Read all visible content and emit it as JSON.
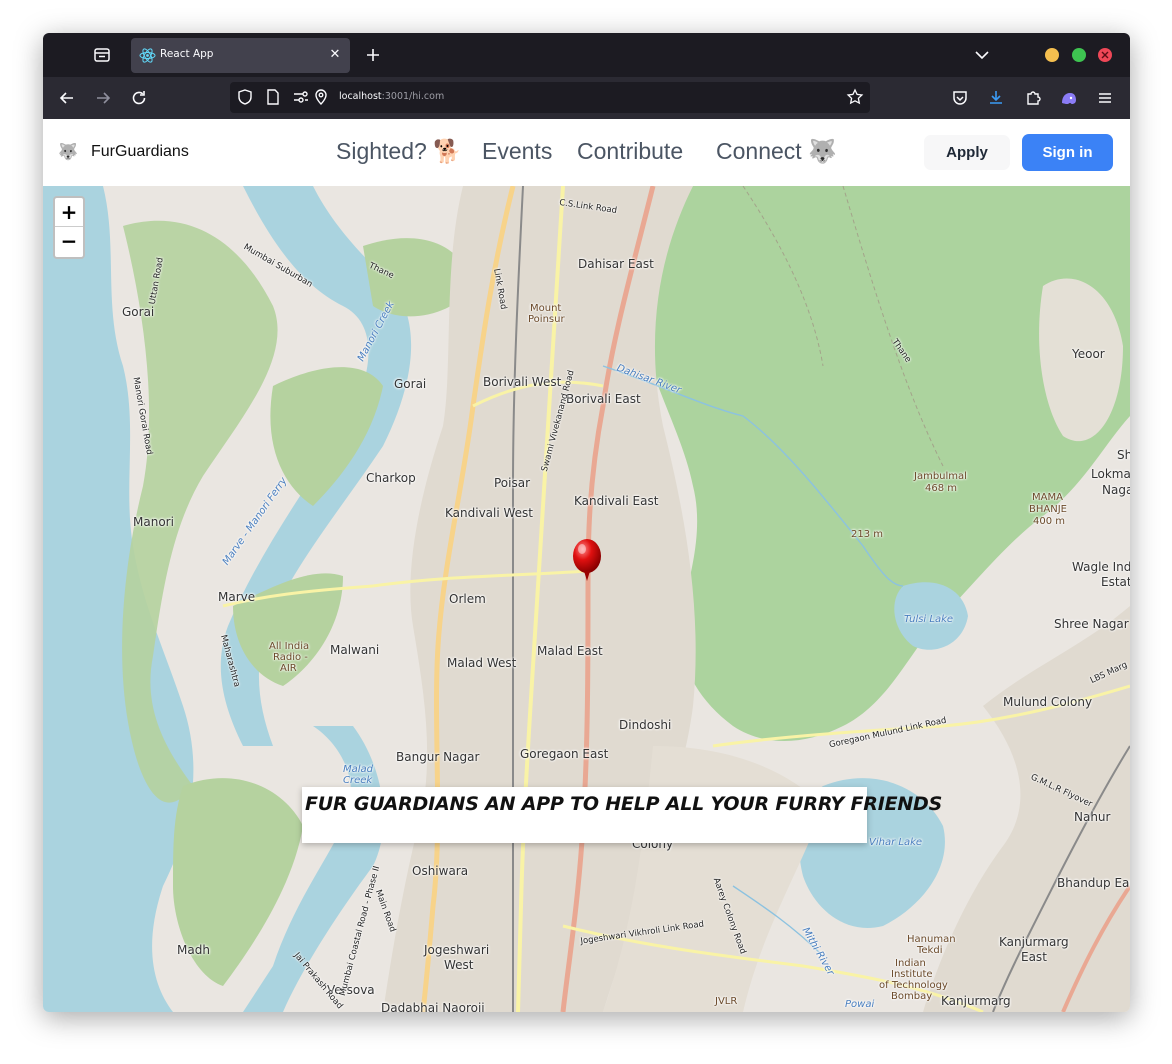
{
  "browser": {
    "tab": {
      "title": "React App",
      "favicon": "react-icon",
      "close_glyph": "✕"
    },
    "url": {
      "host": "localhost",
      "rest": ":3001/hi.com"
    },
    "icons": [
      "tab-list-icon",
      "new-tab-icon",
      "tab-overflow-chevron-icon",
      "back-icon",
      "forward-icon",
      "reload-icon",
      "shield-icon",
      "page-icon",
      "permissions-icon",
      "location-icon",
      "bookmark-star-icon",
      "pocket-icon",
      "downloads-icon",
      "extensions-icon",
      "extension-ghost-icon",
      "menu-icon"
    ],
    "colors": {
      "tabstrip": "#1c1b22",
      "tab_active": "#42414d",
      "toolbar": "#2b2a33"
    }
  },
  "app": {
    "brand": {
      "logo": "🐺",
      "name": "FurGuardians"
    },
    "nav": [
      {
        "label": "Sighted? 🐕"
      },
      {
        "label": "Events"
      },
      {
        "label": "Contribute"
      },
      {
        "label": "Connect 🐺"
      }
    ],
    "apply_label": "Apply",
    "signin_label": "Sign in",
    "colors": {
      "primary": "#3b82f6"
    }
  },
  "map": {
    "zoom_in_label": "+",
    "zoom_out_label": "−",
    "marker_icon": "map-pin-icon",
    "banner_text": "FUR GUARDIANS AN APP TO HELP ALL YOUR FURRY FRIENDS",
    "places": {
      "dahisar_east": "Dahisar East",
      "mount_poinsur_1": "Mount",
      "mount_poinsur_2": "Poinsur",
      "gorai_north": "Gorai",
      "gorai": "Gorai",
      "borivali_west": "Borivali West",
      "borivali_east": "Borivali East",
      "charkop": "Charkop",
      "poisar": "Poisar",
      "kandivali_east": "Kandivali East",
      "kandivali_west": "Kandivali West",
      "manori": "Manori",
      "marve": "Marve",
      "orlem": "Orlem",
      "malwani": "Malwani",
      "malad_west": "Malad West",
      "malad_east": "Malad East",
      "dindoshi": "Dindoshi",
      "bangur_nagar": "Bangur Nagar",
      "goregaon_east": "Goregaon East",
      "oshiwara": "Oshiwara",
      "jogeshwari_1": "Jogeshwari",
      "jogeshwari_2": "West",
      "madh": "Madh",
      "versova": "Versova",
      "dadabhai": "Dadabhai Naoroji",
      "colony": "Colony",
      "yeoor": "Yeoor",
      "lokmanya": "Lokma",
      "nagar_right": "Naga",
      "sh": "Sh",
      "wagle": "Wagle Ind",
      "estate": "Estat",
      "shree_nagar": "Shree Nagar",
      "mulund_colony": "Mulund Colony",
      "nahur": "Nahur",
      "bhandup": "Bhandup Eas",
      "kanjurmarg_e1": "Kanjurmarg",
      "kanjurmarg_e2": "East",
      "kanjurmarg": "Kanjurmarg",
      "hanuman_1": "Hanuman",
      "hanuman_2": "Tekdi",
      "iit_1": "Indian",
      "iit_2": "Institute",
      "iit_3": "of Technology",
      "iit_4": "Bombay",
      "jvlr": "JVLR",
      "powai": "Powai",
      "jambulmal_1": "Jambulmal",
      "jambulmal_2": "468 m",
      "mama_1": "MAMA",
      "mama_2": "BHANJE",
      "mama_3": "400 m",
      "peak_213": "213 m",
      "tulsi_lake": "Tulsi Lake",
      "vihar_lake": "Vihar Lake",
      "malad_creek_1": "Malad",
      "malad_creek_2": "Creek",
      "air_1": "All India",
      "air_2": "Radio -",
      "air_3": "AIR",
      "manori_creek": "Manori Creek",
      "marve_ferry": "Marve - Manori Ferry",
      "thane_west": "Thane",
      "thane_east": "Thane",
      "dahisar_river": "Dahisar River",
      "mithi_river": "Mithi River",
      "cs_link": "C.S.Link Road",
      "link_road": "Link Road",
      "swami_vivekanand": "Swami Vivekanand Road",
      "goregaon_mulund": "Goregaon Mulund Link Road",
      "jvlr_road": "Jogeshwari Vikhroli Link Road",
      "lbs_marg": "LBS Marg",
      "mumbai_suburban": "Mumbai Suburban",
      "uttan_road": "Uttan Road",
      "manori_gorai": "Manori Gorai Road",
      "maharashtra": "Maharashtra",
      "aarey": "Aarey Colony Road",
      "coastal": "Mumbai Coastal Road - Phase II",
      "mahim": "Main Road",
      "jai_prakash": "Jai Prakash Road",
      "glr": "G.M.L.R Flyover"
    }
  }
}
